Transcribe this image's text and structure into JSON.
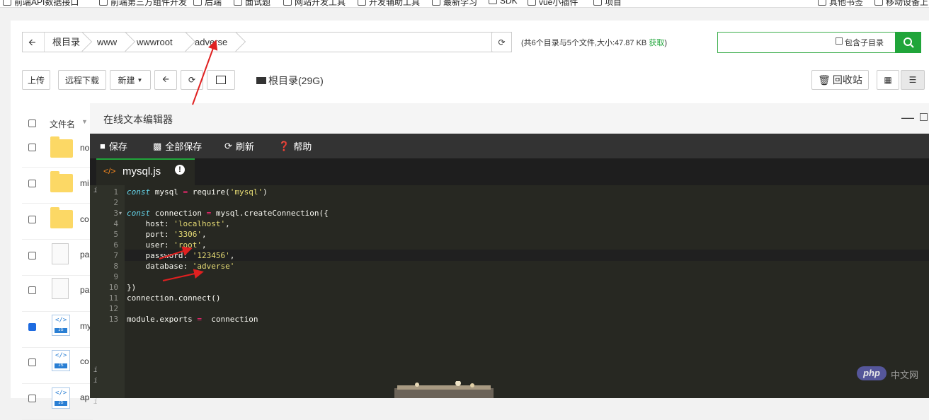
{
  "bookmarks_left": [
    "前端API数据接口",
    "前端第三方组件开发",
    "后端",
    "面试题",
    "网站开发工具",
    "开发辅助工具",
    "最新学习",
    "SDK",
    "vue小插件",
    "项目"
  ],
  "bookmarks_right": [
    "其他书签",
    "移动设备上"
  ],
  "breadcrumb": {
    "back_icon": "arrow-left-icon",
    "items": [
      "根目录",
      "www",
      "wwwroot",
      "adverse"
    ]
  },
  "summary": {
    "text": "(共6个目录与5个文件,大小:47.87 KB ",
    "link": "获取",
    ")": ")"
  },
  "search": {
    "include_sub_label": "包含子目录",
    "button_icon": "search-icon"
  },
  "toolbar": {
    "upload": "上传",
    "remote_download": "远程下载",
    "new": "新建",
    "disk": "根目录(29G)",
    "recycle": "回收站"
  },
  "table": {
    "header": "文件名",
    "rows": [
      {
        "name": "no",
        "type": "folder",
        "checked": false
      },
      {
        "name": "mi",
        "type": "folder",
        "checked": false
      },
      {
        "name": "co",
        "type": "folder",
        "checked": false
      },
      {
        "name": "pa",
        "type": "doc",
        "checked": false
      },
      {
        "name": "pa",
        "type": "doc",
        "checked": false
      },
      {
        "name": "my",
        "type": "js",
        "checked": true
      },
      {
        "name": "co",
        "type": "js",
        "checked": false
      },
      {
        "name": "ap",
        "type": "js",
        "checked": false
      }
    ]
  },
  "editor": {
    "title": "在线文本编辑器",
    "buttons": {
      "save": "保存",
      "save_all": "全部保存",
      "refresh": "刷新",
      "help": "帮助"
    },
    "tab": {
      "filename": "mysql.js",
      "icon": "code-icon",
      "badge_icon": "alert-icon"
    },
    "code": [
      "const mysql = require('mysql')",
      "",
      "const connection = mysql.createConnection({",
      "    host: 'localhost',",
      "    port: '3306',",
      "    user: 'root',",
      "    password: '123456',",
      "    database: 'adverse'",
      "",
      "})",
      "connection.connect()",
      "",
      "module.exports =  connection"
    ],
    "line_numbers": [
      "1",
      "2",
      "3",
      "4",
      "5",
      "6",
      "7",
      "8",
      "9",
      "10",
      "11",
      "12",
      "13"
    ]
  },
  "watermark": {
    "brand": "php",
    "site": "中文网"
  },
  "colors": {
    "accent": "#20a53a",
    "annotation": "#e02020"
  }
}
